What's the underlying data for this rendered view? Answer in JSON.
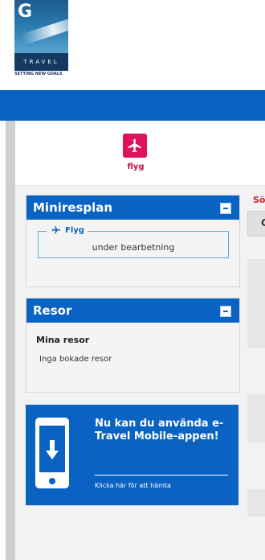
{
  "logo": {
    "letter": "G",
    "band_text": "TRAVEL",
    "tagline": "SETTING NEW GOALS"
  },
  "top_tab": {
    "label": "flyg",
    "icon": "airplane-icon",
    "color": "#e0115b"
  },
  "miniresplan": {
    "title": "Miniresplan",
    "legend": "Flyg",
    "status": "under bearbetning"
  },
  "resor": {
    "title": "Resor",
    "heading": "Mina resor",
    "empty_text": "Inga bokade resor"
  },
  "promo": {
    "text": "Nu kan du använda e-Travel Mobile-appen!",
    "link": "Klicka här för att hämta"
  },
  "search_header": {
    "partial_text": "Sö"
  },
  "right_column": {
    "partial_letter": "C"
  },
  "colors": {
    "primary_blue": "#0a62c2",
    "accent": "#e0115b"
  }
}
